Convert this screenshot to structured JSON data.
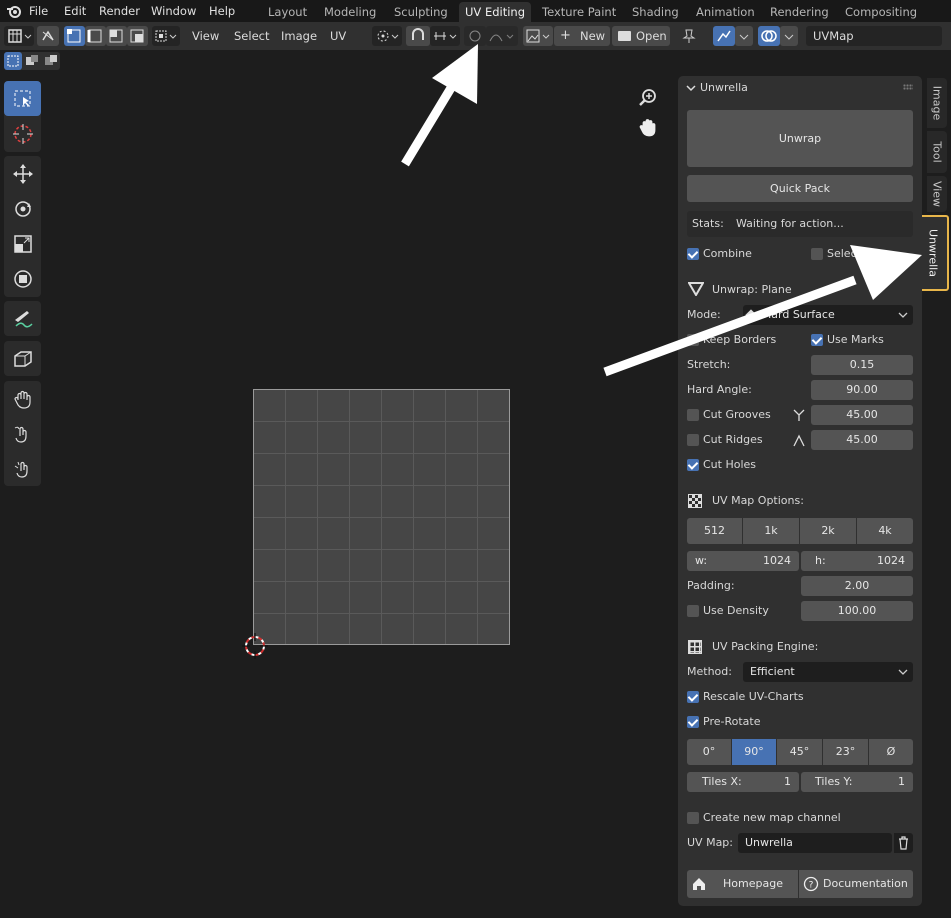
{
  "menubar": {
    "items": [
      "File",
      "Edit",
      "Render",
      "Window",
      "Help"
    ],
    "workspaces": [
      "Layout",
      "Modeling",
      "Sculpting",
      "UV Editing",
      "Texture Paint",
      "Shading",
      "Animation",
      "Rendering",
      "Compositing"
    ],
    "active_workspace": "UV Editing"
  },
  "header": {
    "menus": [
      "View",
      "Select",
      "Image",
      "UV"
    ],
    "new_label": "New",
    "open_label": "Open",
    "uvmap_value": "UVMap"
  },
  "sidebar": {
    "panel_title": "Unwrella",
    "unwrap_label": "Unwrap",
    "quick_pack_label": "Quick Pack",
    "stats_label": "Stats:",
    "stats_value": "Waiting for action...",
    "combine_label": "Combine",
    "selection_label": "Selection",
    "unwrap_heading": "Unwrap: Plane",
    "mode_label": "Mode:",
    "mode_value": "Hard Surface",
    "keep_borders_label": "Keep Borders",
    "use_marks_label": "Use Marks",
    "stretch_label": "Stretch:",
    "stretch_value": "0.15",
    "hard_angle_label": "Hard Angle:",
    "hard_angle_value": "90.00",
    "cut_grooves_label": "Cut Grooves",
    "cut_grooves_value": "45.00",
    "cut_ridges_label": "Cut Ridges",
    "cut_ridges_value": "45.00",
    "cut_holes_label": "Cut Holes",
    "uv_map_options_heading": "UV Map Options:",
    "resolutions": [
      "512",
      "1k",
      "2k",
      "4k"
    ],
    "w_label": "w:",
    "w_value": "1024",
    "h_label": "h:",
    "h_value": "1024",
    "padding_label": "Padding:",
    "padding_value": "2.00",
    "use_density_label": "Use Density",
    "density_value": "100.00",
    "packing_heading": "UV Packing Engine:",
    "method_label": "Method:",
    "method_value": "Efficient",
    "rescale_label": "Rescale UV-Charts",
    "prerotate_label": "Pre-Rotate",
    "rotations": [
      "0°",
      "90°",
      "45°",
      "23°",
      "Ø"
    ],
    "active_rotation": "90°",
    "tiles_x_label": "Tiles X:",
    "tiles_x_value": "1",
    "tiles_y_label": "Tiles Y:",
    "tiles_y_value": "1",
    "create_channel_label": "Create new map channel",
    "uvmap_label": "UV Map:",
    "uvmap_value": "Unwrella",
    "homepage_label": "Homepage",
    "documentation_label": "Documentation"
  },
  "vertical_tabs": [
    "Image",
    "Tool",
    "View",
    "Unwrella"
  ],
  "colors": {
    "accent": "#4772b3",
    "highlight": "#e8b64a",
    "panel": "#303030",
    "field": "#545454"
  }
}
